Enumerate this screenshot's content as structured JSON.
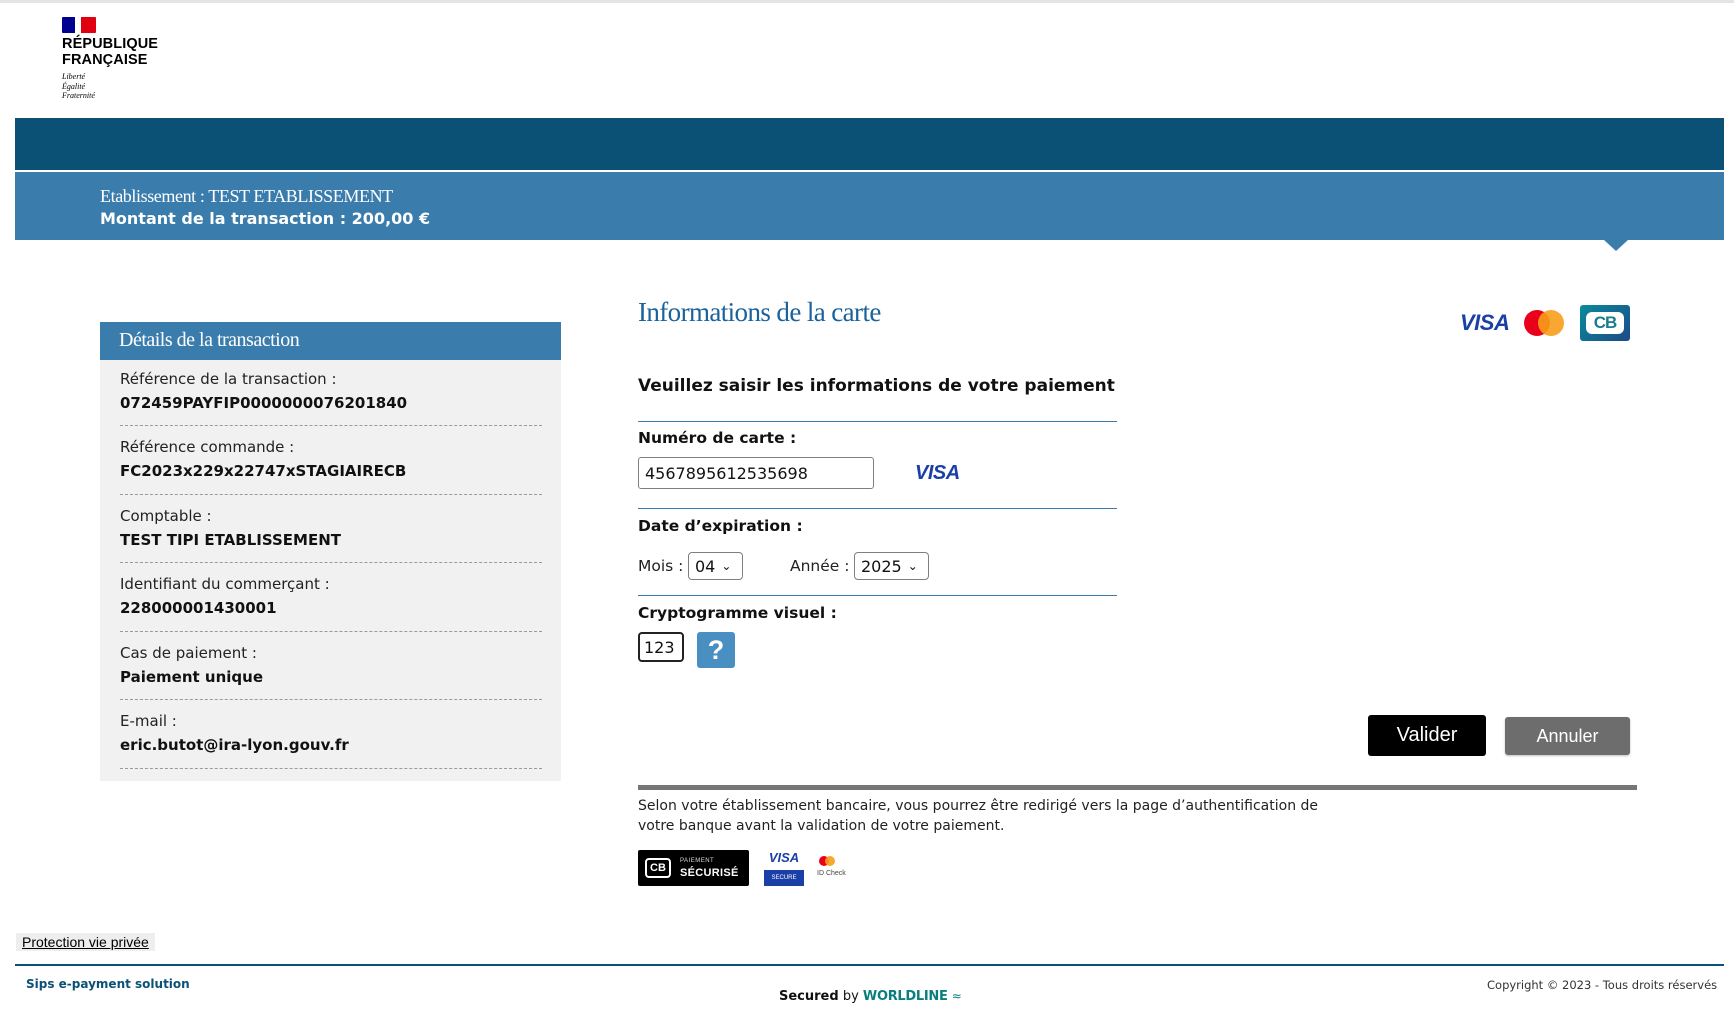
{
  "logo": {
    "name_line1": "RÉPUBLIQUE",
    "name_line2": "FRANÇAISE",
    "motto1": "Liberté",
    "motto2": "Égalité",
    "motto3": "Fraternité"
  },
  "banner": {
    "etablissement": "Etablissement : TEST ETABLISSEMENT",
    "montant": "Montant de la transaction  :   200,00 €"
  },
  "details": {
    "title": "Détails de la transaction",
    "items": [
      {
        "label": "Référence de la transaction :",
        "value": "072459PAYFIP0000000076201840"
      },
      {
        "label": "Référence commande :",
        "value": "FC2023x229x22747xSTAGIAIRECB"
      },
      {
        "label": "Comptable :",
        "value": "TEST TIPI ETABLISSEMENT"
      },
      {
        "label": "Identifiant du commerçant :",
        "value": "228000001430001"
      },
      {
        "label": "Cas de paiement :",
        "value": "Paiement unique"
      },
      {
        "label": "E-mail :",
        "value": "eric.butot@ira-lyon.gouv.fr"
      }
    ]
  },
  "card": {
    "title": "Informations de la carte",
    "brand_logos": {
      "visa": "VISA",
      "mastercard": "mastercard-logo",
      "cb": "CB"
    },
    "instruction": "Veuillez saisir les informations de votre paiement",
    "number_label": "Numéro de carte :",
    "number_value": "4567895612535698",
    "number_brand": "VISA",
    "expiry_label": "Date d’expiration :",
    "month_label": "Mois :",
    "month_value": "04",
    "year_label": "Année :",
    "year_value": "2025",
    "cvv_label": "Cryptogramme visuel :",
    "cvv_value": "123",
    "help": "?"
  },
  "actions": {
    "validate": "Valider",
    "cancel": "Annuler"
  },
  "notice": "Selon votre établissement bancaire, vous pourrez être redirigé vers la page d’authentification de votre banque avant la validation de votre paiement.",
  "badges": {
    "cb_small": "PAIEMENT",
    "cb_big": "SÉCURISÉ",
    "cb_mark": "CB",
    "visa": "VISA",
    "visa_secure": "SECURE",
    "idcheck": "ID Check"
  },
  "footer": {
    "privacy": "Protection vie privée",
    "sips": "Sips e-payment solution",
    "secured_prefix": "Secured",
    "secured_by": "by",
    "worldline": "WORLDLINE",
    "copyright": "Copyright © 2023 - Tous droits réservés"
  },
  "colors": {
    "banner_dark": "#0b5175",
    "banner_light": "#3a7dad",
    "title_blue": "#19629c",
    "validate_bg": "#000000",
    "cancel_bg": "#6d6d6d"
  }
}
